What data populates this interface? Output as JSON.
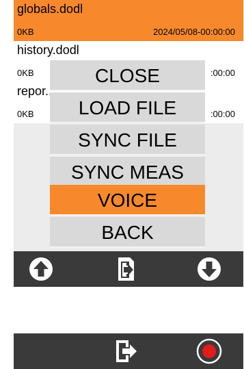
{
  "files": [
    {
      "name": "globals.dodl",
      "size": "0KB",
      "date": "2024/05/08-00:00:00",
      "selected": true
    },
    {
      "name": "history.dodl",
      "size": "0KB",
      "date": ":00:00",
      "selected": false
    },
    {
      "name": "repor...",
      "size": "0KB",
      "date": ":00:00",
      "selected": false
    }
  ],
  "menu": {
    "items": [
      {
        "label": "CLOSE"
      },
      {
        "label": "LOAD FILE"
      },
      {
        "label": "SYNC FILE"
      },
      {
        "label": "SYNC MEAS"
      },
      {
        "label": "VOICE",
        "active": true
      },
      {
        "label": "BACK"
      }
    ]
  },
  "toolbar_top": {
    "icons": [
      "arrow-up-circle-icon",
      "file-import-icon",
      "arrow-down-circle-icon"
    ]
  },
  "toolbar_bottom": {
    "icons": [
      "exit-icon",
      "record-icon"
    ]
  },
  "colors": {
    "accent": "#f7892c",
    "toolbar": "#3a3a3a",
    "menu_bg": "#d9d9d9",
    "record": "#e21b1b"
  }
}
